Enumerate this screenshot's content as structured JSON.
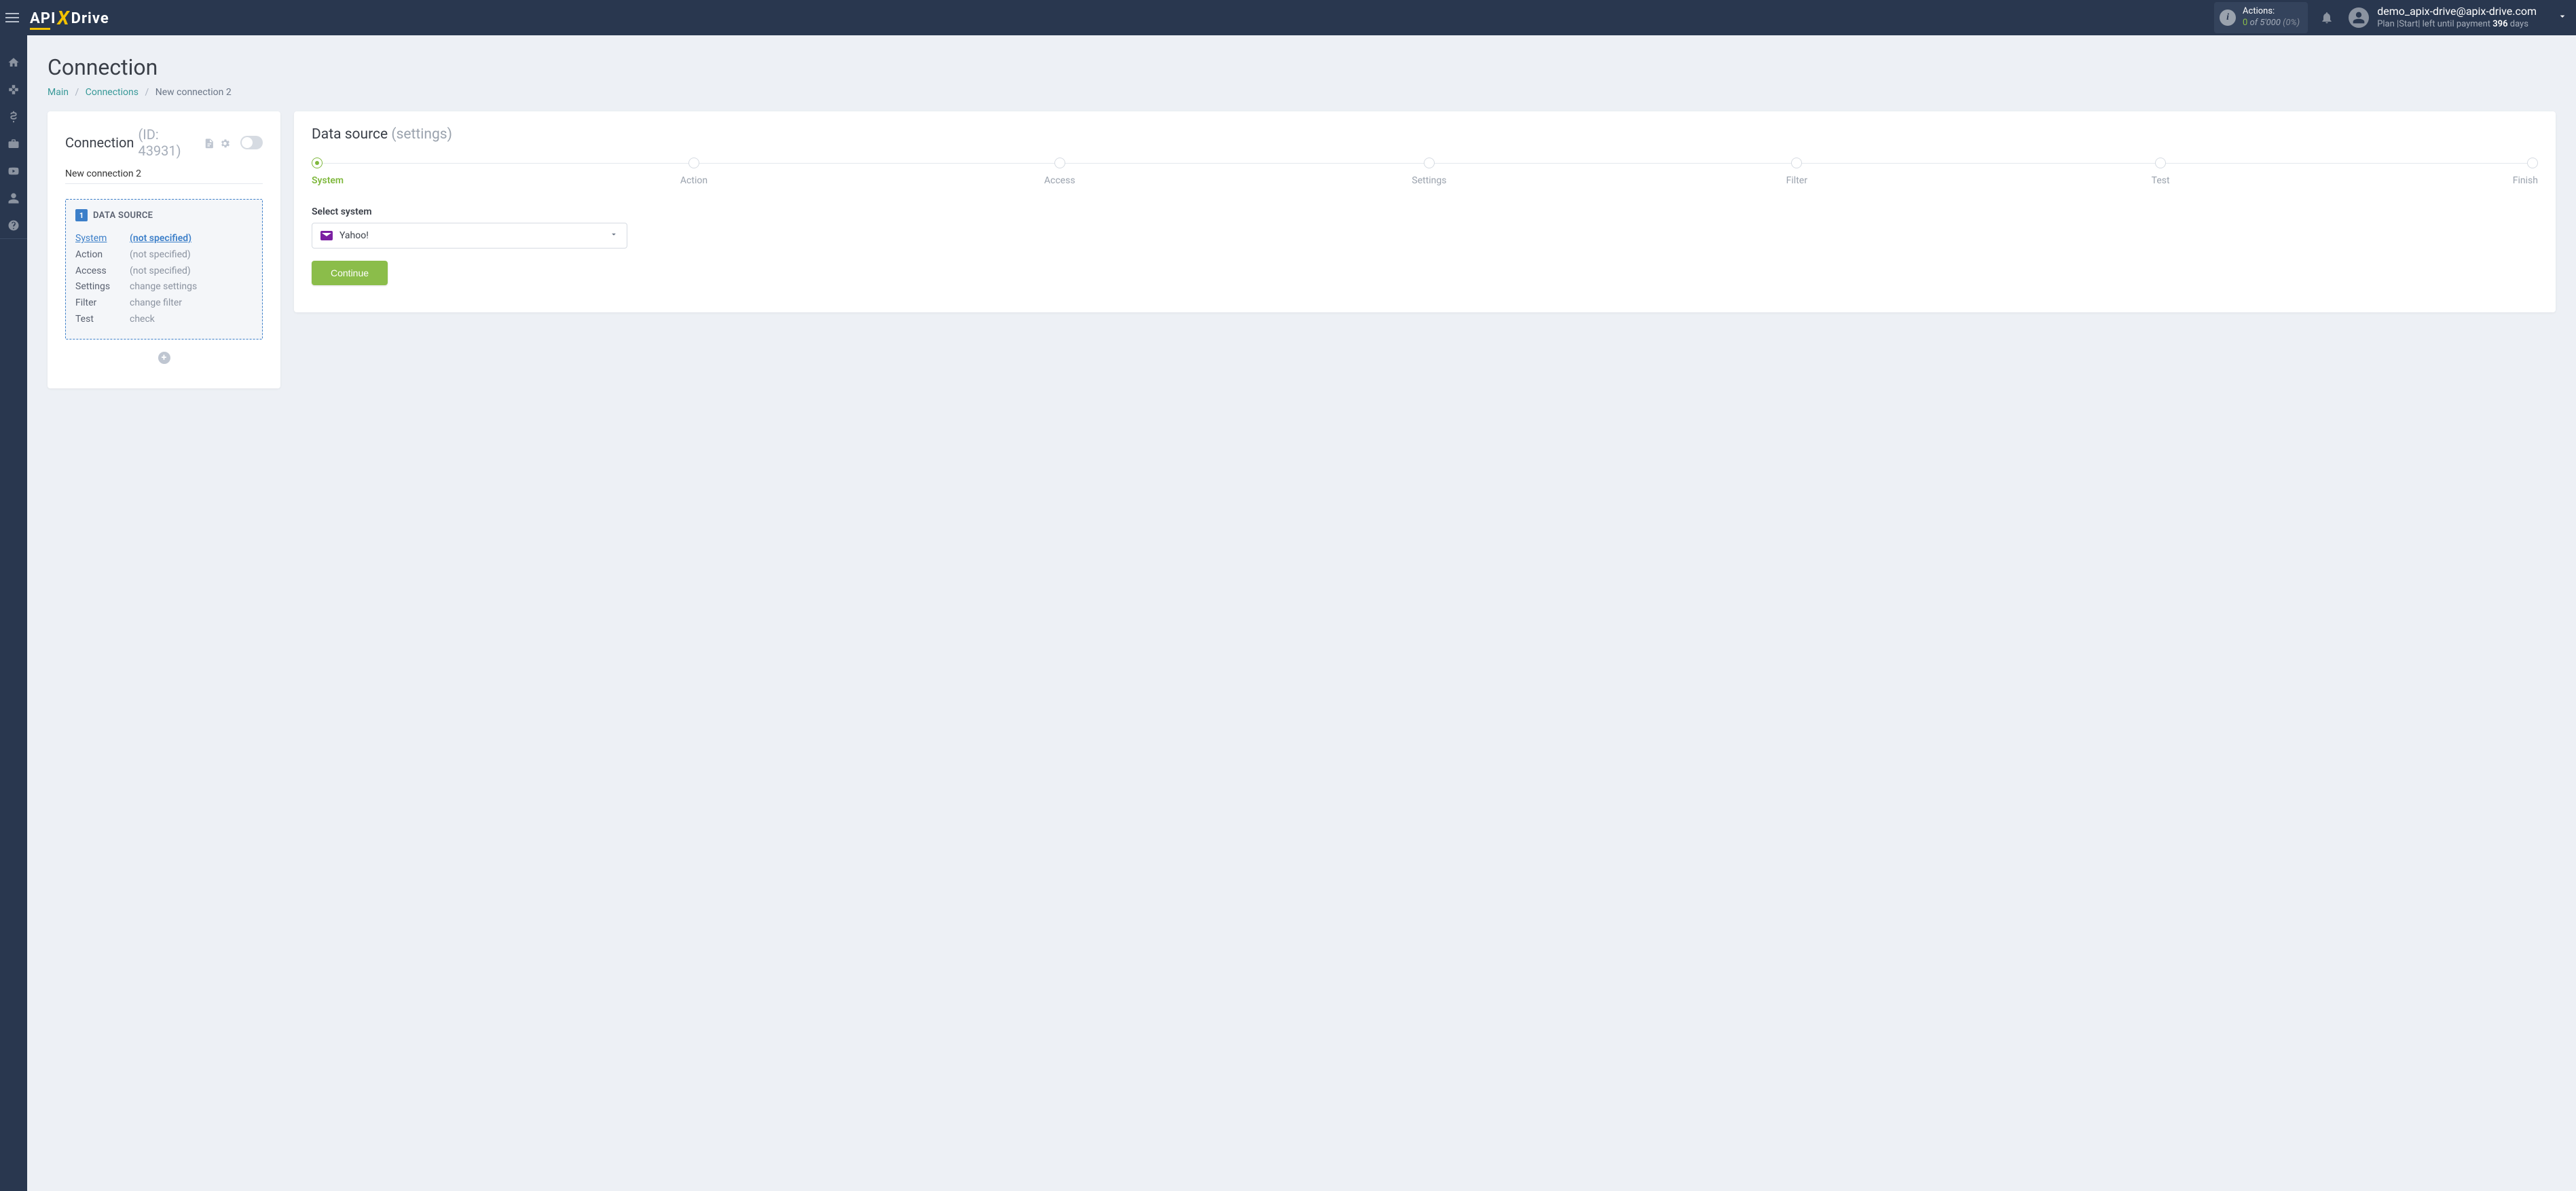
{
  "header": {
    "actions_label": "Actions:",
    "actions_count": "0",
    "actions_of": "of",
    "actions_total": "5'000",
    "actions_pct": "(0%)",
    "user_email": "demo_apix-drive@apix-drive.com",
    "plan_prefix": "Plan |",
    "plan_name": "Start",
    "plan_sep": "|",
    "plan_left": " left until payment ",
    "plan_days": "396",
    "plan_days_suffix": " days"
  },
  "sidebar_icons": [
    "home",
    "sitemap",
    "dollar",
    "briefcase",
    "youtube",
    "user",
    "help"
  ],
  "page": {
    "title": "Connection",
    "breadcrumbs": {
      "main": "Main",
      "connections": "Connections",
      "current": "New connection 2"
    }
  },
  "left_card": {
    "title": "Connection",
    "id_label": "(ID: 43931)",
    "conn_name": "New connection 2",
    "box_badge": "1",
    "box_title": "DATA SOURCE",
    "rows": [
      {
        "k": "System",
        "v": "(not specified)",
        "active": true,
        "link": true
      },
      {
        "k": "Action",
        "v": "(not specified)"
      },
      {
        "k": "Access",
        "v": "(not specified)"
      },
      {
        "k": "Settings",
        "v": "change settings"
      },
      {
        "k": "Filter",
        "v": "change filter"
      },
      {
        "k": "Test",
        "v": "check"
      }
    ]
  },
  "right_card": {
    "title": "Data source",
    "subtitle": "(settings)",
    "steps": [
      "System",
      "Action",
      "Access",
      "Settings",
      "Filter",
      "Test",
      "Finish"
    ],
    "active_step": 0,
    "form_label": "Select system",
    "select_value": "Yahoo!",
    "continue": "Continue"
  }
}
